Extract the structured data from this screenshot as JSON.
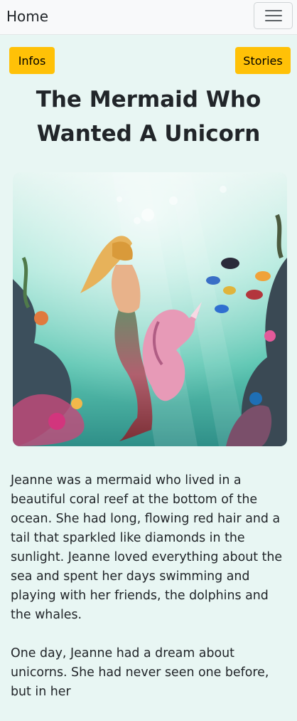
{
  "navbar": {
    "brand": "Home",
    "toggle_icon": "hamburger-menu-icon"
  },
  "actions": {
    "infos_label": "Infos",
    "stories_label": "Stories",
    "button_color": "#ffc107"
  },
  "story": {
    "title_line1": "The Mermaid Who",
    "title_line2": "Wanted A Unicorn",
    "image": "mermaid-and-seahorse-unicorn-underwater-illustration",
    "paragraphs": [
      "Jeanne was a mermaid who lived in a beautiful coral reef at the bottom of the ocean. She had long, flowing red hair and a tail that sparkled like diamonds in the sunlight. Jeanne loved everything about the sea and spent her days swimming and playing with her friends, the dolphins and the whales.",
      "One day, Jeanne had a dream about unicorns. She had never seen one before, but in her"
    ]
  }
}
